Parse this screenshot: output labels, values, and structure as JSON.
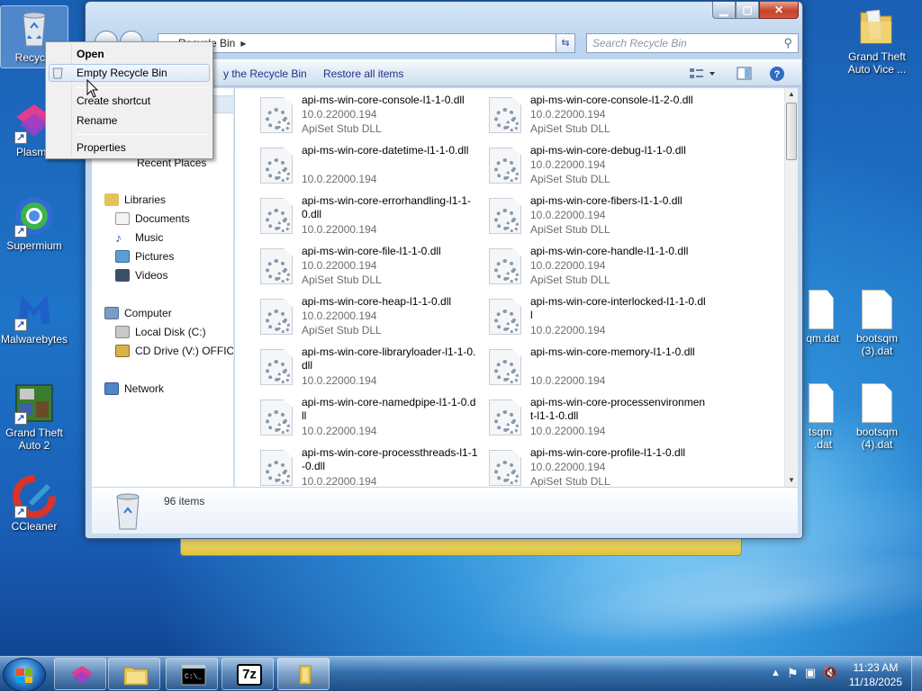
{
  "desktop": {
    "icons": [
      {
        "label": "Recycle Bin",
        "short_label": "Recycle"
      },
      {
        "label": "Plasma"
      },
      {
        "label": "Supermium"
      },
      {
        "label": "Malwarebytes"
      },
      {
        "label": "Grand Theft Auto 2"
      },
      {
        "label": "CCleaner"
      },
      {
        "label": "Grand Theft Auto Vice ..."
      },
      {
        "label": "bootsqm.dat",
        "visible": "qm.dat"
      },
      {
        "label": "bootsqm (3).dat"
      },
      {
        "label": "bootsqm.dat",
        "visible": "tsqm .dat"
      },
      {
        "label": "bootsqm (4).dat"
      }
    ]
  },
  "window": {
    "address": "Recycle Bin",
    "search_placeholder": "Search Recycle Bin",
    "commands": {
      "empty": "Empty the Recycle Bin",
      "empty_visible": "y the Recycle Bin",
      "restore": "Restore all items"
    },
    "nav": {
      "recent": "Recent Places",
      "libraries": "Libraries",
      "documents": "Documents",
      "music": "Music",
      "pictures": "Pictures",
      "videos": "Videos",
      "computer": "Computer",
      "local_disk": "Local Disk (C:)",
      "cd_drive": "CD Drive (V:) OFFICE",
      "network": "Network"
    },
    "files": [
      {
        "name": "api-ms-win-core-console-l1-1-0.dll",
        "version": "10.0.22000.194",
        "desc": "ApiSet Stub DLL"
      },
      {
        "name": "api-ms-win-core-console-l1-2-0.dll",
        "version": "10.0.22000.194",
        "desc": "ApiSet Stub DLL"
      },
      {
        "name": "api-ms-win-core-datetime-l1-1-0.dll",
        "version": "10.0.22000.194",
        "desc": ""
      },
      {
        "name": "api-ms-win-core-debug-l1-1-0.dll",
        "version": "10.0.22000.194",
        "desc": "ApiSet Stub DLL"
      },
      {
        "name": "api-ms-win-core-errorhandling-l1-1-0.dll",
        "version": "10.0.22000.194",
        "desc": ""
      },
      {
        "name": "api-ms-win-core-fibers-l1-1-0.dll",
        "version": "10.0.22000.194",
        "desc": "ApiSet Stub DLL"
      },
      {
        "name": "api-ms-win-core-file-l1-1-0.dll",
        "version": "10.0.22000.194",
        "desc": "ApiSet Stub DLL"
      },
      {
        "name": "api-ms-win-core-handle-l1-1-0.dll",
        "version": "10.0.22000.194",
        "desc": "ApiSet Stub DLL"
      },
      {
        "name": "api-ms-win-core-heap-l1-1-0.dll",
        "version": "10.0.22000.194",
        "desc": "ApiSet Stub DLL"
      },
      {
        "name": "api-ms-win-core-interlocked-l1-1-0.dll",
        "version": "10.0.22000.194",
        "desc": ""
      },
      {
        "name": "api-ms-win-core-libraryloader-l1-1-0.dll",
        "version": "10.0.22000.194",
        "desc": ""
      },
      {
        "name": "api-ms-win-core-memory-l1-1-0.dll",
        "version": "10.0.22000.194",
        "desc": ""
      },
      {
        "name": "api-ms-win-core-namedpipe-l1-1-0.dll",
        "version": "10.0.22000.194",
        "desc": ""
      },
      {
        "name": "api-ms-win-core-processenvironment-l1-1-0.dll",
        "version": "10.0.22000.194",
        "desc": ""
      },
      {
        "name": "api-ms-win-core-processthreads-l1-1-0.dll",
        "version": "10.0.22000.194",
        "desc": ""
      },
      {
        "name": "api-ms-win-core-profile-l1-1-0.dll",
        "version": "10.0.22000.194",
        "desc": "ApiSet Stub DLL"
      }
    ],
    "item_count": "96 items"
  },
  "context_menu": {
    "items": [
      "Open",
      "Empty Recycle Bin",
      "Create shortcut",
      "Rename",
      "Properties"
    ]
  },
  "taskbar": {
    "time": "11:23 AM",
    "date": "11/18/2025",
    "sevenzip_label": "7z"
  }
}
